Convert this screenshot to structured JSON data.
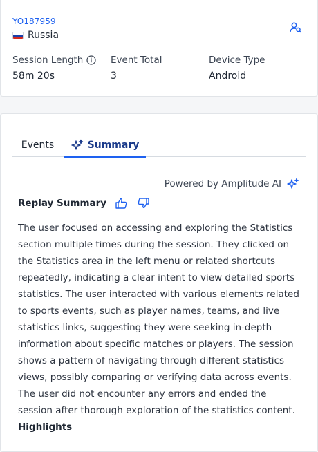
{
  "user": {
    "id": "YO187959",
    "country": "Russia",
    "flag_colors": [
      "#ffffff",
      "#1c3fa8",
      "#d52b1e"
    ]
  },
  "stats": [
    {
      "label": "Session Length",
      "value": "58m 20s"
    },
    {
      "label": "Event Total",
      "value": "3"
    },
    {
      "label": "Device Type",
      "value": "Android"
    }
  ],
  "tabs": {
    "events_label": "Events",
    "summary_label": "Summary",
    "active": "Summary"
  },
  "summary": {
    "powered_by": "Powered by Amplitude AI",
    "title": "Replay Summary",
    "text": "The user focused on accessing and exploring the Statistics section multiple times during the session. They clicked on the Statistics area in the left menu or related shortcuts repeatedly, indicating a clear intent to view detailed sports statistics. The user interacted with various elements related to sports events, such as player names, teams, and live statistics links, suggesting they were seeking in-depth information about specific matches or players. The session shows a pattern of navigating through different statistics views, possibly comparing or verifying data across events. The user did not encounter any errors and ended the session after thorough exploration of the statistics content.",
    "highlights_title": "Highlights"
  },
  "colors": {
    "accent": "#1e61f0",
    "active_tab_text": "#1a3a8a"
  },
  "icons": [
    "user-search-icon",
    "info-icon",
    "sparkle-icon",
    "thumbs-up-icon",
    "thumbs-down-icon"
  ]
}
